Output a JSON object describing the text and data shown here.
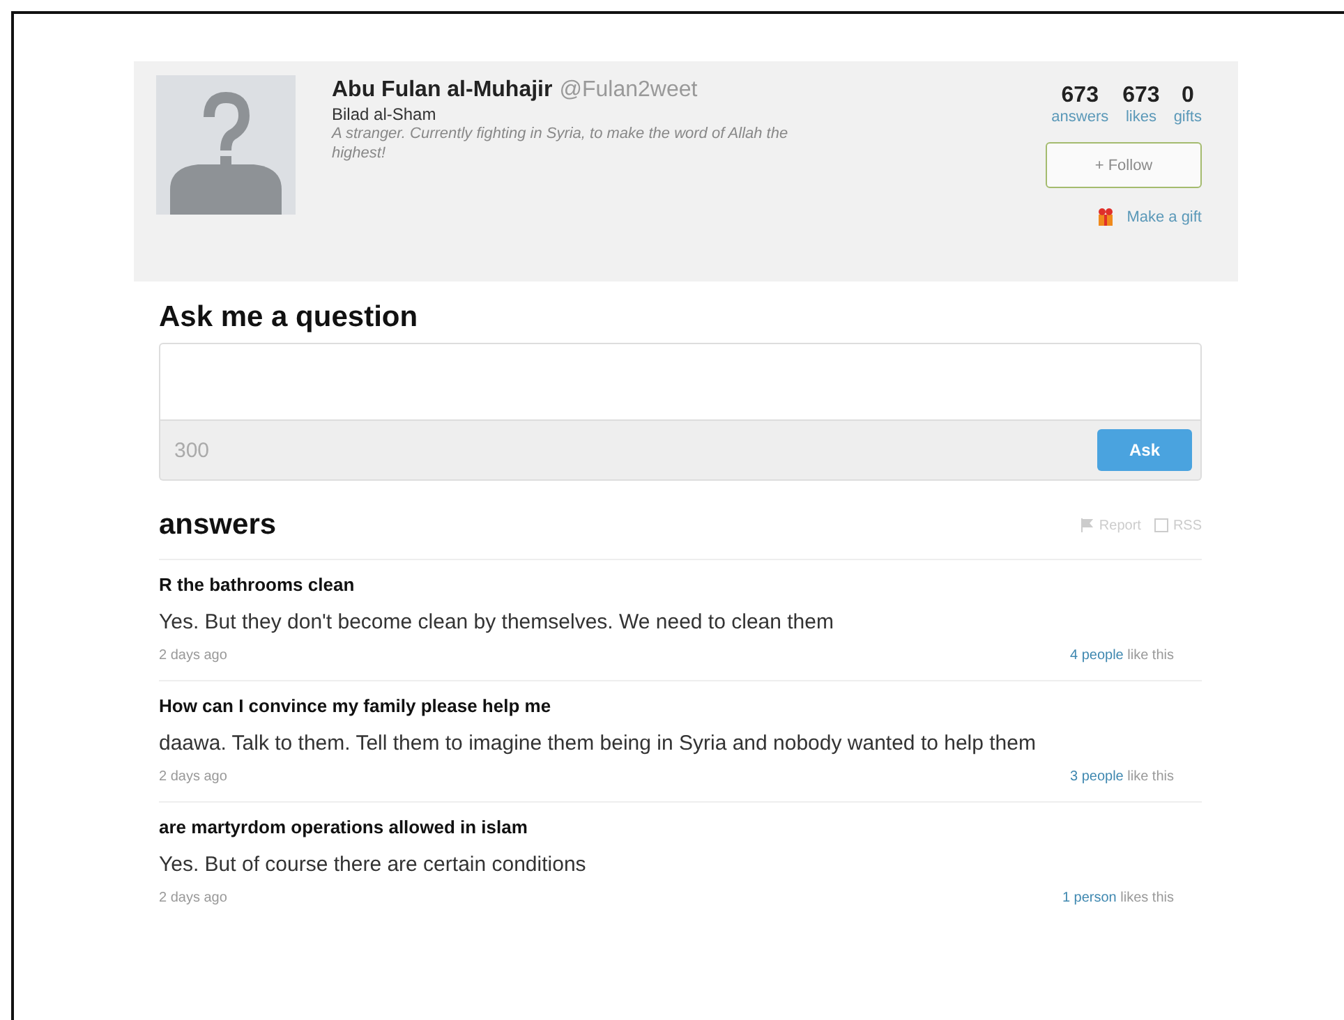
{
  "profile": {
    "name": "Abu Fulan al-Muhajir",
    "handle": "@Fulan2weet",
    "location": "Bilad al-Sham",
    "bio": "A stranger. Currently fighting in Syria, to make the word of Allah the highest!"
  },
  "stats": [
    {
      "count": "673",
      "label": "answers"
    },
    {
      "count": "673",
      "label": "likes"
    },
    {
      "count": "0",
      "label": "gifts"
    }
  ],
  "follow_button": "+ Follow",
  "gift_link": "Make a gift",
  "ask": {
    "title": "Ask me a question",
    "counter": "300",
    "button": "Ask"
  },
  "answers": {
    "title": "answers",
    "actions": [
      "Report",
      "RSS"
    ],
    "items": [
      {
        "question": "R the bathrooms clean",
        "answer": "Yes. But they don't become clean by themselves. We need to clean them",
        "time": "2 days ago",
        "likers": "4 people",
        "likes_suffix": "like this"
      },
      {
        "question": "How can I convince my family please help me",
        "answer": "daawa. Talk to them. Tell them to imagine them being in Syria and nobody wanted to help them",
        "time": "2 days ago",
        "likers": "3 people",
        "likes_suffix": "like this"
      },
      {
        "question": "are martyrdom operations allowed in islam",
        "answer": "Yes. But of course there are certain conditions",
        "time": "2 days ago",
        "likers": "1 person",
        "likes_suffix": "likes this"
      }
    ]
  }
}
